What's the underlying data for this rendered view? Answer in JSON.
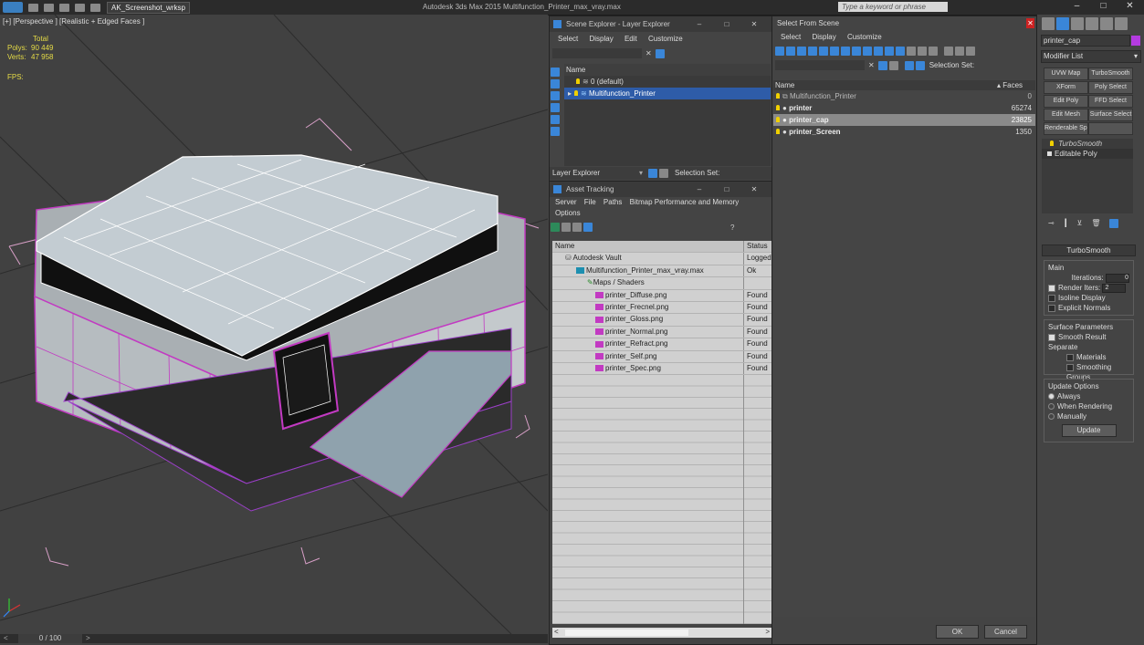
{
  "titlebar": {
    "workspace": "AK_Screenshot_wrksp",
    "app_title": "Autodesk 3ds Max 2015    Multifunction_Printer_max_vray.max",
    "search_placeholder": "Type a keyword or phrase"
  },
  "viewport": {
    "label": "[+] [Perspective ] [Realistic + Edged Faces ]",
    "total_label": "Total",
    "polys_label": "Polys:",
    "polys_value": "90 449",
    "verts_label": "Verts:",
    "verts_value": "47 958",
    "fps_label": "FPS:"
  },
  "timebar": {
    "frame": "0 / 100"
  },
  "scene_explorer": {
    "title": "Scene Explorer - Layer Explorer",
    "menu": [
      "Select",
      "Display",
      "Edit",
      "Customize"
    ],
    "tree_header": "Name",
    "tree": [
      {
        "label": "0 (default)"
      },
      {
        "label": "Multifunction_Printer"
      }
    ],
    "footer_label": "Layer Explorer",
    "selection_set": "Selection Set:"
  },
  "asset_tracking": {
    "title": "Asset Tracking",
    "menu": [
      "Server",
      "File",
      "Paths",
      "Bitmap Performance and Memory"
    ],
    "menu2": "Options",
    "col_name": "Name",
    "col_status": "Status",
    "rows": [
      {
        "name": "Autodesk Vault",
        "status": "Logged"
      },
      {
        "name": "Multifunction_Printer_max_vray.max",
        "status": "Ok"
      },
      {
        "name": "Maps / Shaders",
        "status": ""
      },
      {
        "name": "printer_Diffuse.png",
        "status": "Found"
      },
      {
        "name": "printer_Frecnel.png",
        "status": "Found"
      },
      {
        "name": "printer_Gloss.png",
        "status": "Found"
      },
      {
        "name": "printer_Normal.png",
        "status": "Found"
      },
      {
        "name": "printer_Refract.png",
        "status": "Found"
      },
      {
        "name": "printer_Self.png",
        "status": "Found"
      },
      {
        "name": "printer_Spec.png",
        "status": "Found"
      }
    ]
  },
  "select_from_scene": {
    "title": "Select From Scene",
    "menu": [
      "Select",
      "Display",
      "Customize"
    ],
    "selection_set": "Selection Set:",
    "col_name": "Name",
    "col_faces": "Faces",
    "rows": [
      {
        "name": "Multifunction_Printer",
        "faces": "0"
      },
      {
        "name": "printer",
        "faces": "65274"
      },
      {
        "name": "printer_cap",
        "faces": "23825"
      },
      {
        "name": "printer_Screen",
        "faces": "1350"
      }
    ],
    "ok": "OK",
    "cancel": "Cancel"
  },
  "command_panel": {
    "object_name": "printer_cap",
    "modifier_list": "Modifier List",
    "buttons": [
      "UVW Map",
      "TurboSmooth",
      "XForm",
      "Poly Select",
      "Edit Poly",
      "FFD Select",
      "Edit Mesh",
      "Surface Select",
      "Renderable Spline",
      ""
    ],
    "stack": [
      "TurboSmooth",
      "Editable Poly"
    ],
    "rollout_title": "TurboSmooth",
    "main_label": "Main",
    "iterations_label": "Iterations:",
    "iterations_value": "0",
    "render_iters_label": "Render Iters:",
    "render_iters_value": "2",
    "isoline": "Isoline Display",
    "explicit_normals": "Explicit Normals",
    "surface_params": "Surface Parameters",
    "smooth_result": "Smooth Result",
    "separate": "Separate",
    "materials": "Materials",
    "smoothing_groups": "Smoothing Groups",
    "update_options": "Update Options",
    "always": "Always",
    "when_rendering": "When Rendering",
    "manually": "Manually",
    "update_btn": "Update"
  },
  "colors": {
    "accent": "#2e5ca8",
    "wireframe": "#c23ac2",
    "stats": "#e6dc46"
  }
}
